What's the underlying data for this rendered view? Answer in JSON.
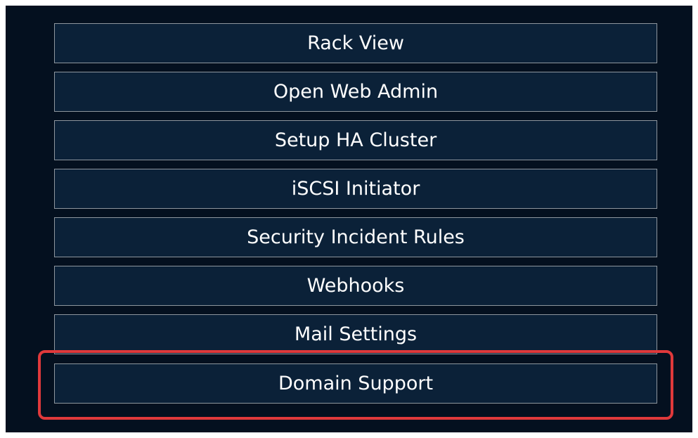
{
  "menu": {
    "items": [
      {
        "label": "Rack View"
      },
      {
        "label": "Open Web Admin"
      },
      {
        "label": "Setup HA Cluster"
      },
      {
        "label": "iSCSI Initiator"
      },
      {
        "label": "Security Incident Rules"
      },
      {
        "label": "Webhooks"
      },
      {
        "label": "Mail Settings"
      },
      {
        "label": "Domain Support"
      }
    ]
  },
  "colors": {
    "panel_background": "#04101f",
    "button_background": "#0b2138",
    "button_border": "#8e969e",
    "highlight": "#e0393b"
  }
}
